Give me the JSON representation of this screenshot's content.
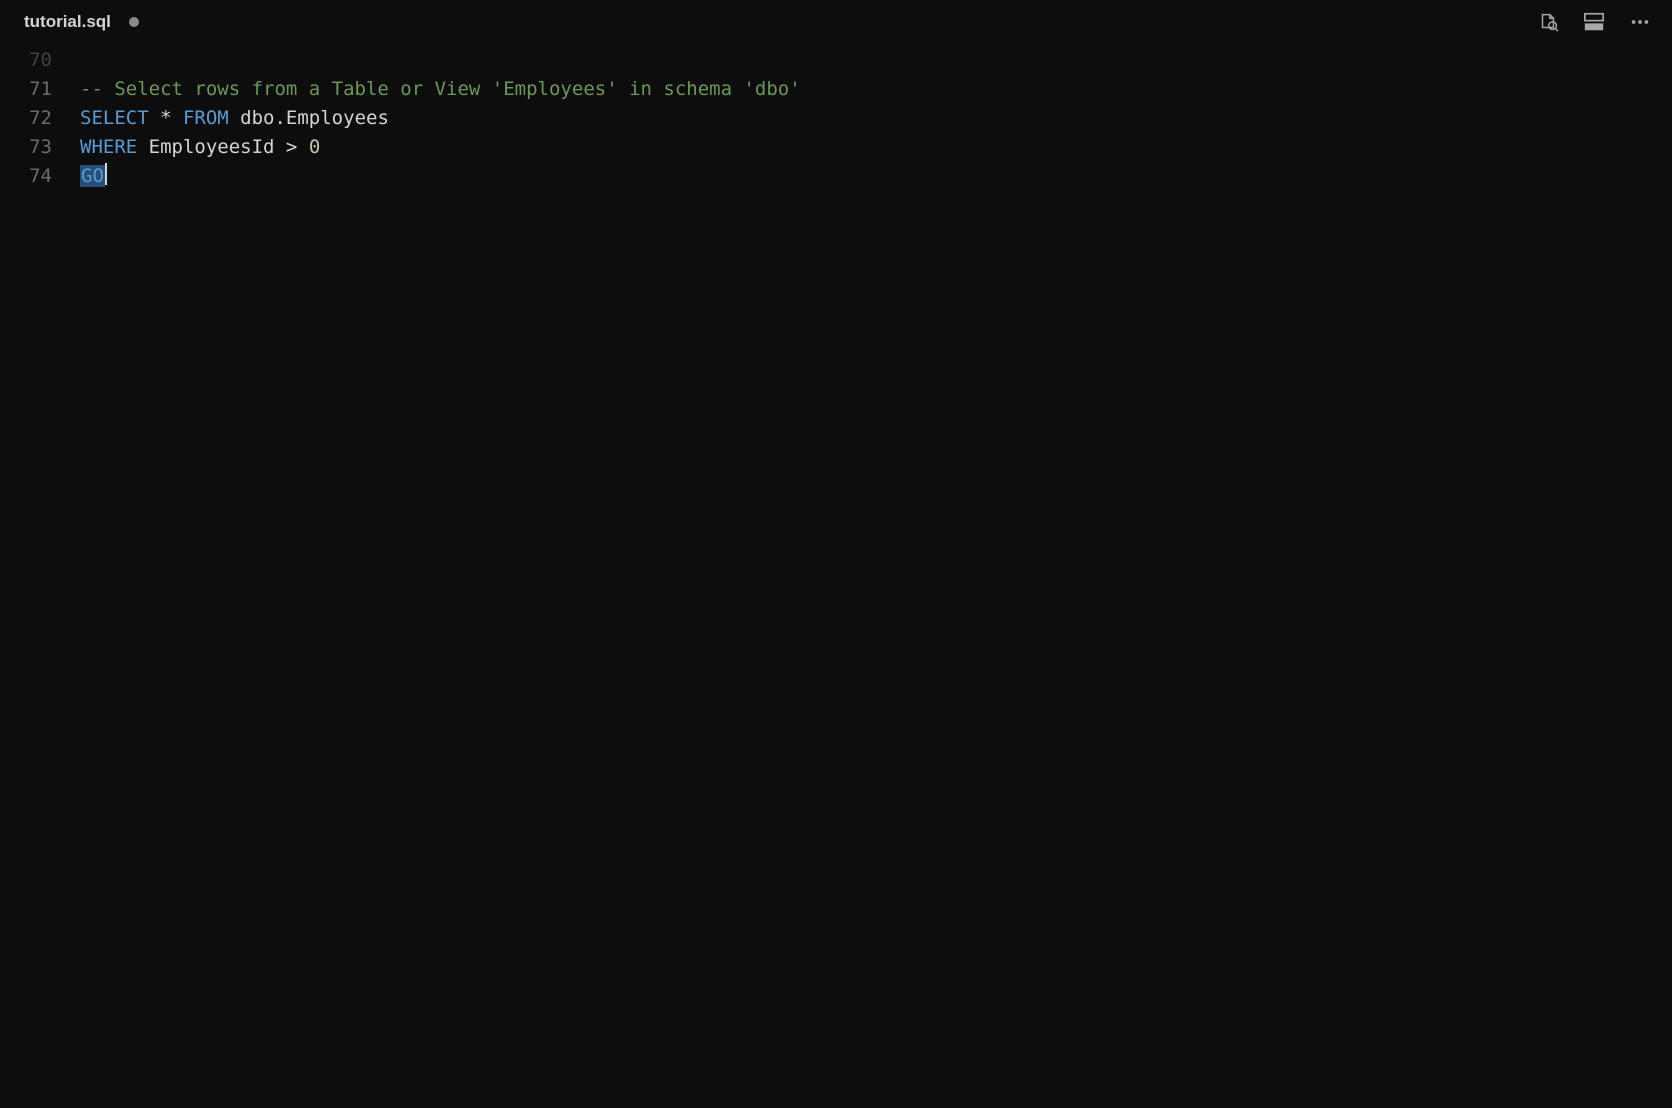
{
  "tab": {
    "label": "tutorial.sql",
    "dirty": true
  },
  "gutter": {
    "lines": [
      70,
      71,
      72,
      73,
      74
    ],
    "faded_first": true
  },
  "code": {
    "lines": [
      {
        "tokens": [
          {
            "class": "tok-comment",
            "text": ""
          }
        ]
      },
      {
        "tokens": [
          {
            "class": "tok-comment",
            "text": "-- Select rows from a Table or View 'Employees' in schema 'dbo'"
          }
        ]
      },
      {
        "tokens": [
          {
            "class": "tok-keyword",
            "text": "SELECT"
          },
          {
            "class": "tok-star",
            "text": " * "
          },
          {
            "class": "tok-keyword",
            "text": "FROM"
          },
          {
            "class": "tok-ident",
            "text": " dbo.Employees"
          }
        ]
      },
      {
        "tokens": [
          {
            "class": "tok-keyword",
            "text": "WHERE"
          },
          {
            "class": "tok-ident",
            "text": " EmployeesId "
          },
          {
            "class": "tok-operator",
            "text": ">"
          },
          {
            "class": "tok-ident",
            "text": " "
          },
          {
            "class": "tok-number",
            "text": "0"
          }
        ]
      },
      {
        "tokens": [
          {
            "class": "tok-go",
            "text": "GO"
          }
        ],
        "has_cursor": true
      }
    ]
  }
}
